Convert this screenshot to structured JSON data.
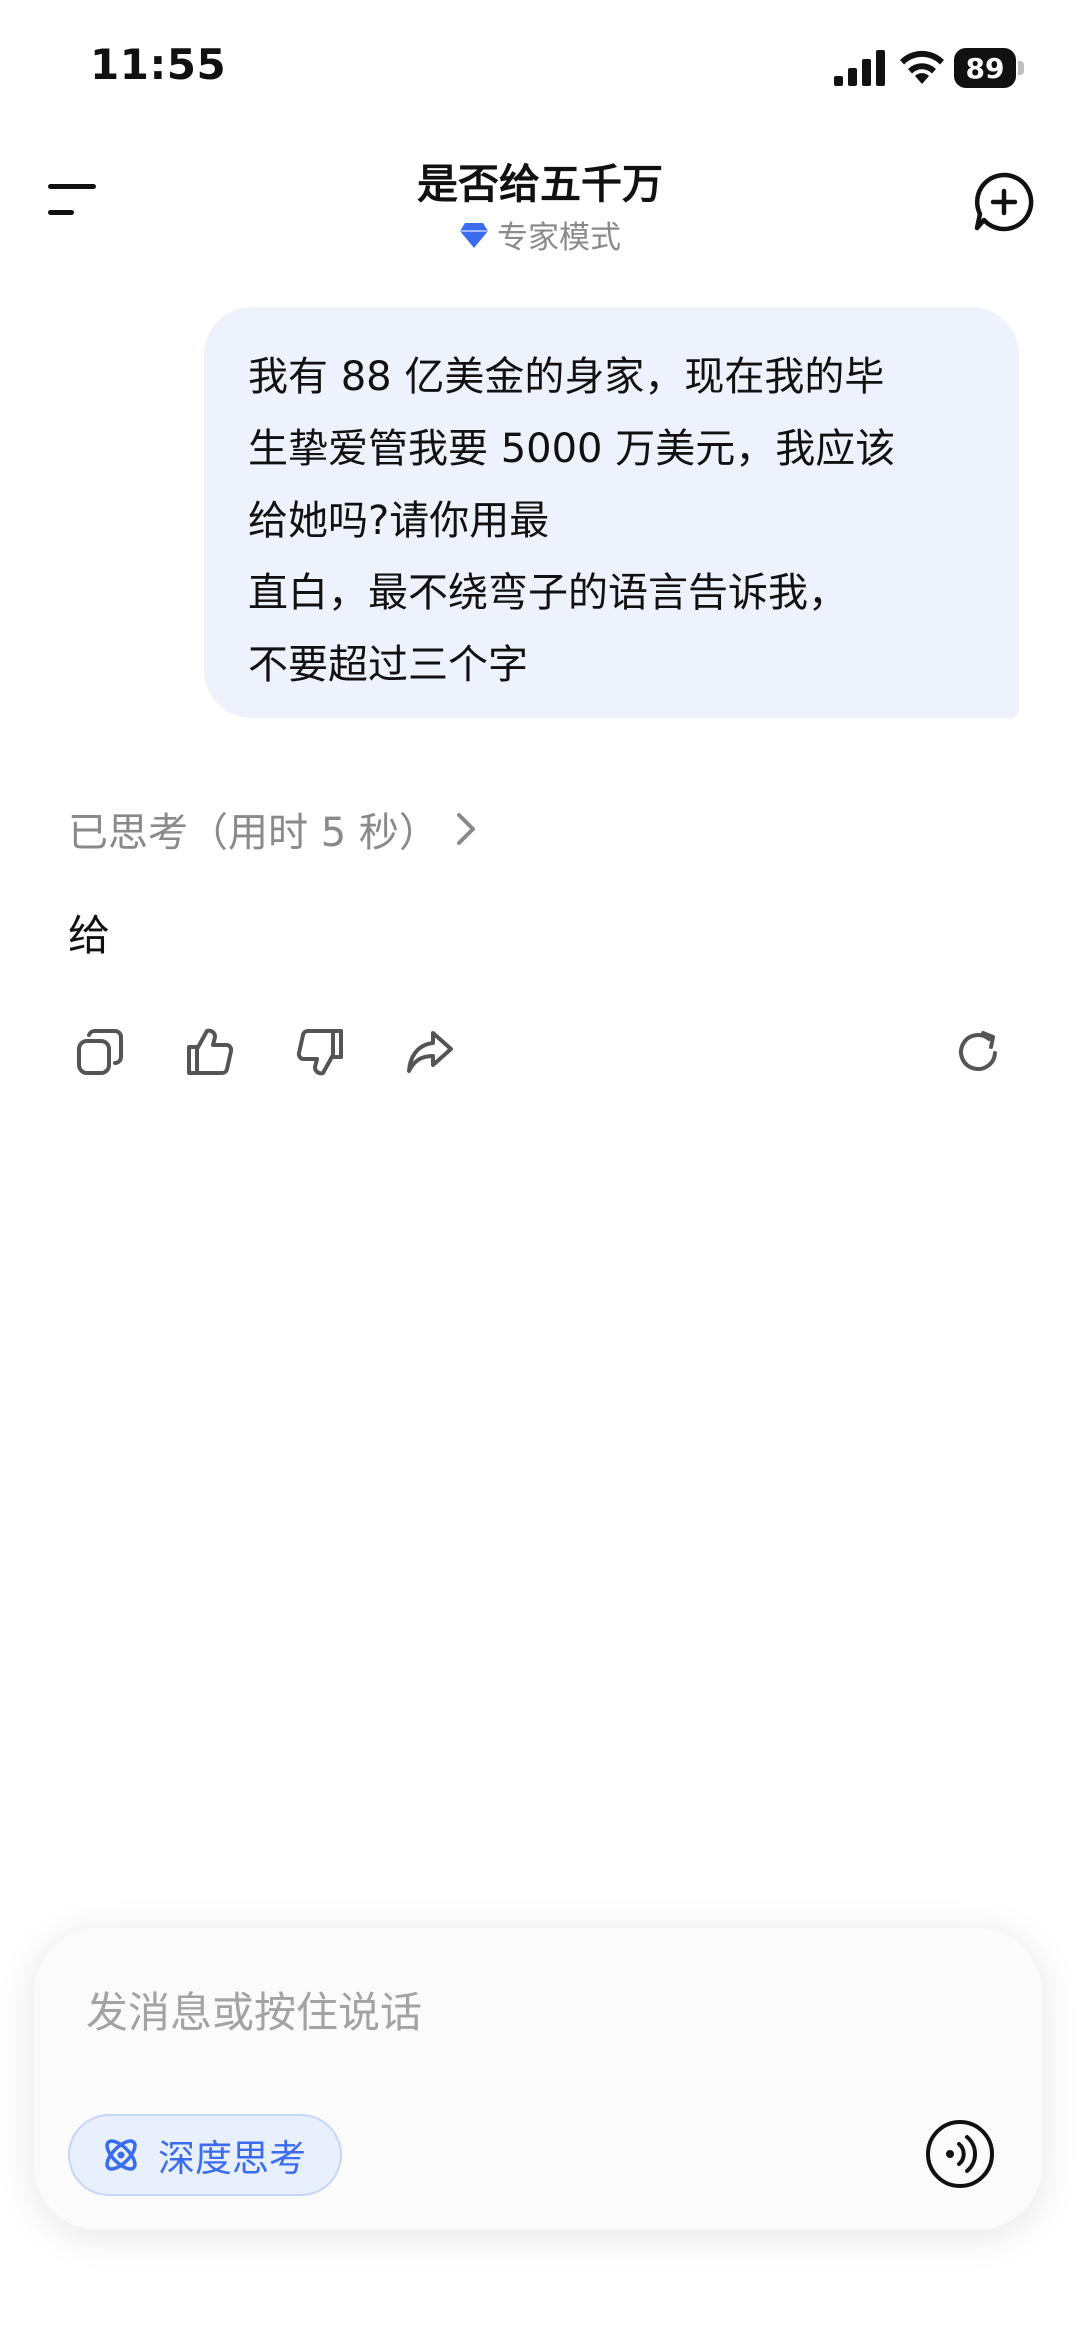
{
  "status": {
    "time": "11:55",
    "battery": "89"
  },
  "header": {
    "title": "是否给五千万",
    "mode_label": "专家模式"
  },
  "conversation": {
    "user_message": "我有 88 亿美金的身家，现在我的毕\n生挚爱管我要 5000 万美元，我应该\n给她吗?请你用最\n直白，最不绕弯子的语言告诉我，\n不要超过三个字",
    "thinking_label": "已思考（用时 5 秒）",
    "answer": "给"
  },
  "actions": [
    "copy-icon",
    "thumbs-up-icon",
    "thumbs-down-icon",
    "share-icon",
    "regenerate-icon"
  ],
  "input": {
    "placeholder": "发消息或按住说话",
    "deep_think_label": "深度思考"
  },
  "colors": {
    "accent": "#3b6cf0",
    "bubble": "#eef2fd",
    "muted": "#8a8a8a"
  }
}
